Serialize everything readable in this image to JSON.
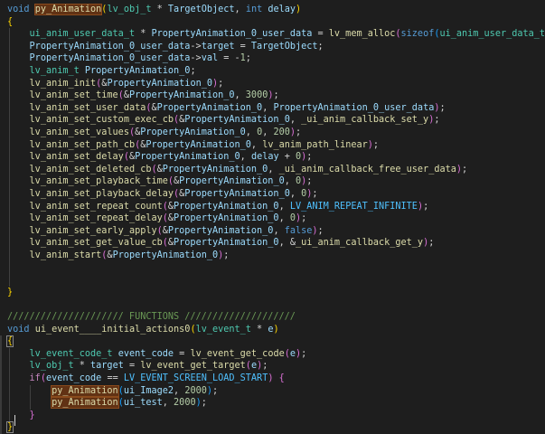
{
  "editor": {
    "language": "c",
    "theme_colors": {
      "background": "#1e1e1e",
      "keyword": "#569cd6",
      "control": "#c586c0",
      "function": "#dcdcaa",
      "type": "#4ec9b0",
      "variable": "#9cdcfe",
      "number": "#b5cea8",
      "comment": "#6a9955"
    },
    "lines": [
      [
        [
          "k",
          "void"
        ],
        [
          "p",
          " "
        ],
        [
          "f hl",
          "py_Animation"
        ],
        [
          "b1",
          "("
        ],
        [
          "t",
          "lv_obj_t"
        ],
        [
          "p",
          " * "
        ],
        [
          "v",
          "TargetObject"
        ],
        [
          "p",
          ", "
        ],
        [
          "k",
          "int"
        ],
        [
          "p",
          " "
        ],
        [
          "v",
          "delay"
        ],
        [
          "b1",
          ")"
        ]
      ],
      [
        [
          "b1",
          "{"
        ]
      ],
      [
        [
          "p",
          "    "
        ],
        [
          "t",
          "ui_anim_user_data_t"
        ],
        [
          "p",
          " * "
        ],
        [
          "v",
          "PropertyAnimation_0_user_data"
        ],
        [
          "p",
          " = "
        ],
        [
          "f",
          "lv_mem_alloc"
        ],
        [
          "b2",
          "("
        ],
        [
          "k",
          "sizeof"
        ],
        [
          "b3",
          "("
        ],
        [
          "t",
          "ui_anim_user_data_t"
        ],
        [
          "b3",
          ")"
        ],
        [
          "b2",
          ")"
        ],
        [
          "p",
          ";"
        ]
      ],
      [
        [
          "p",
          "    "
        ],
        [
          "v",
          "PropertyAnimation_0_user_data"
        ],
        [
          "p",
          "->"
        ],
        [
          "v",
          "target"
        ],
        [
          "p",
          " = "
        ],
        [
          "v",
          "TargetObject"
        ],
        [
          "p",
          ";"
        ]
      ],
      [
        [
          "p",
          "    "
        ],
        [
          "v",
          "PropertyAnimation_0_user_data"
        ],
        [
          "p",
          "->"
        ],
        [
          "v",
          "val"
        ],
        [
          "p",
          " = -"
        ],
        [
          "n",
          "1"
        ],
        [
          "p",
          ";"
        ]
      ],
      [
        [
          "p",
          "    "
        ],
        [
          "t",
          "lv_anim_t"
        ],
        [
          "p",
          " "
        ],
        [
          "v",
          "PropertyAnimation_0"
        ],
        [
          "p",
          ";"
        ]
      ],
      [
        [
          "p",
          "    "
        ],
        [
          "f",
          "lv_anim_init"
        ],
        [
          "b2",
          "("
        ],
        [
          "p",
          "&"
        ],
        [
          "v",
          "PropertyAnimation_0"
        ],
        [
          "b2",
          ")"
        ],
        [
          "p",
          ";"
        ]
      ],
      [
        [
          "p",
          "    "
        ],
        [
          "f",
          "lv_anim_set_time"
        ],
        [
          "b2",
          "("
        ],
        [
          "p",
          "&"
        ],
        [
          "v",
          "PropertyAnimation_0"
        ],
        [
          "p",
          ", "
        ],
        [
          "n",
          "3000"
        ],
        [
          "b2",
          ")"
        ],
        [
          "p",
          ";"
        ]
      ],
      [
        [
          "p",
          "    "
        ],
        [
          "f",
          "lv_anim_set_user_data"
        ],
        [
          "b2",
          "("
        ],
        [
          "p",
          "&"
        ],
        [
          "v",
          "PropertyAnimation_0"
        ],
        [
          "p",
          ", "
        ],
        [
          "v",
          "PropertyAnimation_0_user_data"
        ],
        [
          "b2",
          ")"
        ],
        [
          "p",
          ";"
        ]
      ],
      [
        [
          "p",
          "    "
        ],
        [
          "f",
          "lv_anim_set_custom_exec_cb"
        ],
        [
          "b2",
          "("
        ],
        [
          "p",
          "&"
        ],
        [
          "v",
          "PropertyAnimation_0"
        ],
        [
          "p",
          ", "
        ],
        [
          "f",
          "_ui_anim_callback_set_y"
        ],
        [
          "b2",
          ")"
        ],
        [
          "p",
          ";"
        ]
      ],
      [
        [
          "p",
          "    "
        ],
        [
          "f",
          "lv_anim_set_values"
        ],
        [
          "b2",
          "("
        ],
        [
          "p",
          "&"
        ],
        [
          "v",
          "PropertyAnimation_0"
        ],
        [
          "p",
          ", "
        ],
        [
          "n",
          "0"
        ],
        [
          "p",
          ", "
        ],
        [
          "n",
          "200"
        ],
        [
          "b2",
          ")"
        ],
        [
          "p",
          ";"
        ]
      ],
      [
        [
          "p",
          "    "
        ],
        [
          "f",
          "lv_anim_set_path_cb"
        ],
        [
          "b2",
          "("
        ],
        [
          "p",
          "&"
        ],
        [
          "v",
          "PropertyAnimation_0"
        ],
        [
          "p",
          ", "
        ],
        [
          "f",
          "lv_anim_path_linear"
        ],
        [
          "b2",
          ")"
        ],
        [
          "p",
          ";"
        ]
      ],
      [
        [
          "p",
          "    "
        ],
        [
          "f",
          "lv_anim_set_delay"
        ],
        [
          "b2",
          "("
        ],
        [
          "p",
          "&"
        ],
        [
          "v",
          "PropertyAnimation_0"
        ],
        [
          "p",
          ", "
        ],
        [
          "v",
          "delay"
        ],
        [
          "p",
          " + "
        ],
        [
          "n",
          "0"
        ],
        [
          "b2",
          ")"
        ],
        [
          "p",
          ";"
        ]
      ],
      [
        [
          "p",
          "    "
        ],
        [
          "f",
          "lv_anim_set_deleted_cb"
        ],
        [
          "b2",
          "("
        ],
        [
          "p",
          "&"
        ],
        [
          "v",
          "PropertyAnimation_0"
        ],
        [
          "p",
          ", "
        ],
        [
          "f",
          "_ui_anim_callback_free_user_data"
        ],
        [
          "b2",
          ")"
        ],
        [
          "p",
          ";"
        ]
      ],
      [
        [
          "p",
          "    "
        ],
        [
          "f",
          "lv_anim_set_playback_time"
        ],
        [
          "b2",
          "("
        ],
        [
          "p",
          "&"
        ],
        [
          "v",
          "PropertyAnimation_0"
        ],
        [
          "p",
          ", "
        ],
        [
          "n",
          "0"
        ],
        [
          "b2",
          ")"
        ],
        [
          "p",
          ";"
        ]
      ],
      [
        [
          "p",
          "    "
        ],
        [
          "f",
          "lv_anim_set_playback_delay"
        ],
        [
          "b2",
          "("
        ],
        [
          "p",
          "&"
        ],
        [
          "v",
          "PropertyAnimation_0"
        ],
        [
          "p",
          ", "
        ],
        [
          "n",
          "0"
        ],
        [
          "b2",
          ")"
        ],
        [
          "p",
          ";"
        ]
      ],
      [
        [
          "p",
          "    "
        ],
        [
          "f",
          "lv_anim_set_repeat_count"
        ],
        [
          "b2",
          "("
        ],
        [
          "p",
          "&"
        ],
        [
          "v",
          "PropertyAnimation_0"
        ],
        [
          "p",
          ", "
        ],
        [
          "m",
          "LV_ANIM_REPEAT_INFINITE"
        ],
        [
          "b2",
          ")"
        ],
        [
          "p",
          ";"
        ]
      ],
      [
        [
          "p",
          "    "
        ],
        [
          "f",
          "lv_anim_set_repeat_delay"
        ],
        [
          "b2",
          "("
        ],
        [
          "p",
          "&"
        ],
        [
          "v",
          "PropertyAnimation_0"
        ],
        [
          "p",
          ", "
        ],
        [
          "n",
          "0"
        ],
        [
          "b2",
          ")"
        ],
        [
          "p",
          ";"
        ]
      ],
      [
        [
          "p",
          "    "
        ],
        [
          "f",
          "lv_anim_set_early_apply"
        ],
        [
          "b2",
          "("
        ],
        [
          "p",
          "&"
        ],
        [
          "v",
          "PropertyAnimation_0"
        ],
        [
          "p",
          ", "
        ],
        [
          "k",
          "false"
        ],
        [
          "b2",
          ")"
        ],
        [
          "p",
          ";"
        ]
      ],
      [
        [
          "p",
          "    "
        ],
        [
          "f",
          "lv_anim_set_get_value_cb"
        ],
        [
          "b2",
          "("
        ],
        [
          "p",
          "&"
        ],
        [
          "v",
          "PropertyAnimation_0"
        ],
        [
          "p",
          ", &"
        ],
        [
          "f",
          "_ui_anim_callback_get_y"
        ],
        [
          "b2",
          ")"
        ],
        [
          "p",
          ";"
        ]
      ],
      [
        [
          "p",
          "    "
        ],
        [
          "f",
          "lv_anim_start"
        ],
        [
          "b2",
          "("
        ],
        [
          "p",
          "&"
        ],
        [
          "v",
          "PropertyAnimation_0"
        ],
        [
          "b2",
          ")"
        ],
        [
          "p",
          ";"
        ]
      ],
      [],
      [],
      [
        [
          "b1",
          "}"
        ]
      ],
      [],
      [
        [
          "cm",
          "///////////////////// FUNCTIONS ////////////////////"
        ]
      ],
      [
        [
          "k",
          "void"
        ],
        [
          "p",
          " "
        ],
        [
          "f",
          "ui_event____initial_actions0"
        ],
        [
          "b1",
          "("
        ],
        [
          "t",
          "lv_event_t"
        ],
        [
          "p",
          " * "
        ],
        [
          "v",
          "e"
        ],
        [
          "b1",
          ")"
        ]
      ],
      [
        [
          "b1 bm",
          "{"
        ]
      ],
      [
        [
          "p",
          "    "
        ],
        [
          "t",
          "lv_event_code_t"
        ],
        [
          "p",
          " "
        ],
        [
          "v",
          "event_code"
        ],
        [
          "p",
          " = "
        ],
        [
          "f",
          "lv_event_get_code"
        ],
        [
          "b2",
          "("
        ],
        [
          "v",
          "e"
        ],
        [
          "b2",
          ")"
        ],
        [
          "p",
          ";"
        ]
      ],
      [
        [
          "p",
          "    "
        ],
        [
          "t",
          "lv_obj_t"
        ],
        [
          "p",
          " * "
        ],
        [
          "v",
          "target"
        ],
        [
          "p",
          " = "
        ],
        [
          "f",
          "lv_event_get_target"
        ],
        [
          "b2",
          "("
        ],
        [
          "v",
          "e"
        ],
        [
          "b2",
          ")"
        ],
        [
          "p",
          ";"
        ]
      ],
      [
        [
          "p",
          "    "
        ],
        [
          "c",
          "if"
        ],
        [
          "b2",
          "("
        ],
        [
          "v",
          "event_code"
        ],
        [
          "p",
          " == "
        ],
        [
          "m",
          "LV_EVENT_SCREEN_LOAD_START"
        ],
        [
          "b2",
          ")"
        ],
        [
          "p",
          " "
        ],
        [
          "b2",
          "{"
        ]
      ],
      [
        [
          "p",
          "        "
        ],
        [
          "f hl",
          "py_Animation"
        ],
        [
          "b3",
          "("
        ],
        [
          "v",
          "ui_Image2"
        ],
        [
          "p",
          ", "
        ],
        [
          "n",
          "2000"
        ],
        [
          "b3",
          ")"
        ],
        [
          "p",
          ";"
        ]
      ],
      [
        [
          "p",
          "        "
        ],
        [
          "f hl",
          "py_Animation"
        ],
        [
          "b3",
          "("
        ],
        [
          "v",
          "ui_test"
        ],
        [
          "p",
          ", "
        ],
        [
          "n",
          "2000"
        ],
        [
          "b3",
          ")"
        ],
        [
          "p",
          ";"
        ]
      ],
      [
        [
          "p",
          "    "
        ],
        [
          "b2",
          "}"
        ]
      ],
      [
        [
          "b1 bm",
          "}"
        ]
      ]
    ]
  }
}
